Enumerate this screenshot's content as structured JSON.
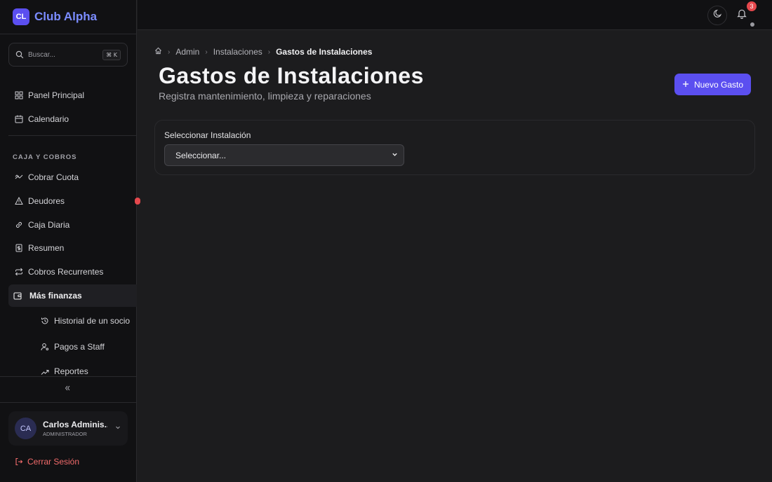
{
  "brand": {
    "logo": "CL",
    "name": "Club Alpha"
  },
  "search": {
    "placeholder": "Buscar...",
    "shortcut": "⌘ K"
  },
  "sidebar": {
    "top_items": [
      {
        "label": "Panel Principal",
        "icon": "dashboard-icon"
      },
      {
        "label": "Calendario",
        "icon": "calendar-icon"
      }
    ],
    "section_label": "CAJA Y COBROS",
    "items": [
      {
        "label": "Cobrar Cuota",
        "icon": "coins-icon"
      },
      {
        "label": "Deudores",
        "icon": "alert-triangle-icon"
      },
      {
        "label": "Caja Diaria",
        "icon": "link-icon"
      },
      {
        "label": "Resumen",
        "icon": "receipt-icon"
      },
      {
        "label": "Cobros Recurrentes",
        "icon": "repeat-icon"
      },
      {
        "label": "Más finanzas",
        "icon": "wallet-icon",
        "active": true
      }
    ],
    "sub_items": [
      {
        "label": "Historial de un socio",
        "icon": "history-icon"
      },
      {
        "label": "Pagos a Staff",
        "icon": "user-cog-icon"
      },
      {
        "label": "Reportes",
        "icon": "trending-up-icon"
      }
    ],
    "collapse_icon": "chevrons-left-icon"
  },
  "user": {
    "initials": "CA",
    "name": "Carlos Adminis...",
    "role": "ADMINISTRADOR"
  },
  "logout_label": "Cerrar Sesión",
  "topbar": {
    "notification_count": "3"
  },
  "breadcrumb": {
    "items": [
      "Admin",
      "Instalaciones"
    ],
    "current": "Gastos de Instalaciones"
  },
  "page": {
    "title": "Gastos de Instalaciones",
    "subtitle": "Registra mantenimiento, limpieza y reparaciones",
    "new_button": "Nuevo Gasto"
  },
  "form": {
    "label": "Seleccionar Instalación",
    "select_value": "Seleccionar..."
  },
  "colors": {
    "accent": "#5b4ff0",
    "brand_text": "#7b8cff",
    "danger": "#e5484d"
  }
}
